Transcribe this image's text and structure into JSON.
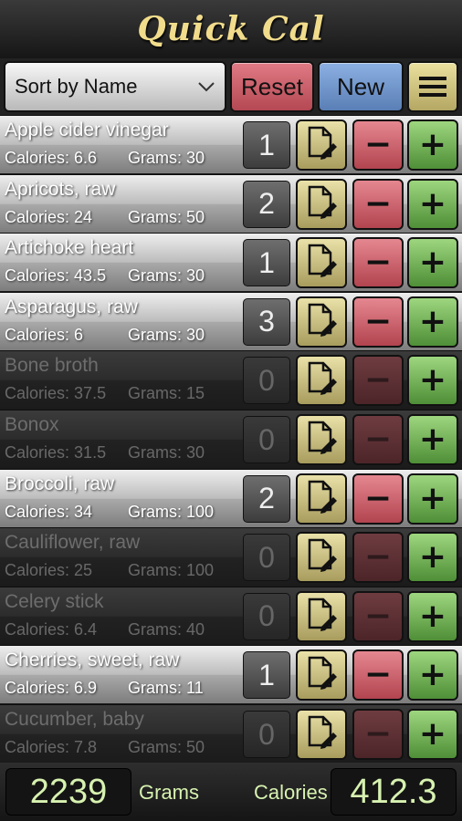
{
  "app": {
    "title": "Quick Cal"
  },
  "toolbar": {
    "sort_label": "Sort by Name",
    "reset_label": "Reset",
    "new_label": "New"
  },
  "labels": {
    "calories": "Calories:",
    "grams": "Grams:"
  },
  "colors": {
    "title": "#f1dc8c",
    "reset": "#c85a65",
    "new": "#7398cc",
    "minus": "#cc5f69",
    "plus": "#72b157",
    "edit": "#cdc283",
    "totals_text": "#d7f2b0"
  },
  "items": [
    {
      "name": "Apple cider vinegar",
      "calories": "6.6",
      "grams": "30",
      "count": "1",
      "active": true
    },
    {
      "name": "Apricots, raw",
      "calories": "24",
      "grams": "50",
      "count": "2",
      "active": true
    },
    {
      "name": "Artichoke heart",
      "calories": "43.5",
      "grams": "30",
      "count": "1",
      "active": true
    },
    {
      "name": "Asparagus, raw",
      "calories": "6",
      "grams": "30",
      "count": "3",
      "active": true
    },
    {
      "name": "Bone broth",
      "calories": "37.5",
      "grams": "15",
      "count": "0",
      "active": false
    },
    {
      "name": "Bonox",
      "calories": "31.5",
      "grams": "30",
      "count": "0",
      "active": false
    },
    {
      "name": "Broccoli, raw",
      "calories": "34",
      "grams": "100",
      "count": "2",
      "active": true
    },
    {
      "name": "Cauliflower, raw",
      "calories": "25",
      "grams": "100",
      "count": "0",
      "active": false
    },
    {
      "name": "Celery stick",
      "calories": "6.4",
      "grams": "40",
      "count": "0",
      "active": false
    },
    {
      "name": "Cherries, sweet, raw",
      "calories": "6.9",
      "grams": "11",
      "count": "1",
      "active": true
    },
    {
      "name": "Cucumber, baby",
      "calories": "7.8",
      "grams": "50",
      "count": "0",
      "active": false
    }
  ],
  "icons": {
    "edit": "document-edit-icon",
    "minus": "minus-icon",
    "plus": "plus-icon",
    "menu": "menu-icon",
    "dropdown": "chevron-down-icon"
  },
  "footer": {
    "total_grams": "2239",
    "grams_label": "Grams",
    "calories_label": "Calories",
    "total_calories": "412.3"
  }
}
